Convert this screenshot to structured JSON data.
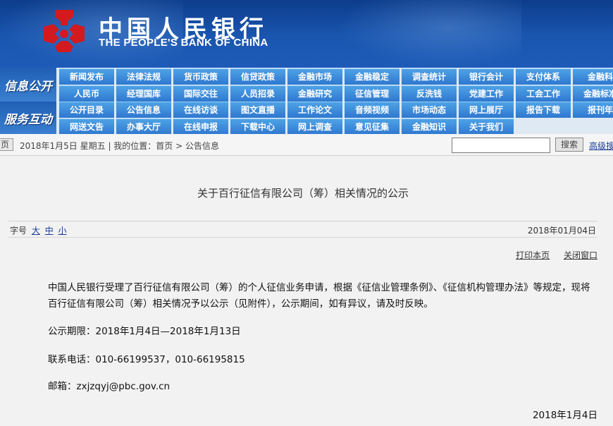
{
  "header": {
    "logo_cn": "中国人民银行",
    "logo_en": "THE PEOPLE'S BANK OF CHINA",
    "brand_color": "#c8171e"
  },
  "nav": {
    "group1_label": "信息公开",
    "group2_label": "服务互动",
    "row1": [
      "新闻发布",
      "法律法规",
      "货币政策",
      "信贷政策",
      "金融市场",
      "金融稳定",
      "调查统计",
      "银行会计",
      "支付体系",
      "金融科"
    ],
    "row2": [
      "人民币",
      "经理国库",
      "国际交往",
      "人员招录",
      "金融研究",
      "征信管理",
      "反洗钱",
      "党建工作",
      "工会工作",
      "金融标准"
    ],
    "row3": [
      "公开目录",
      "公告信息",
      "在线访谈",
      "图文直播",
      "工作论文",
      "音频视频",
      "市场动态",
      "网上展厅",
      "报告下载",
      "报刊年"
    ],
    "row4": [
      "网送文告",
      "办事大厅",
      "在线申报",
      "下载中心",
      "网上调查",
      "意见征集",
      "金融知识",
      "关于我们"
    ]
  },
  "crumbbar": {
    "home": "页",
    "text": "2018年1月5日  星期五  |  我的位置：首页   >  公告信息",
    "search_placeholder": "",
    "search_button": "搜索",
    "advanced": "高级搜"
  },
  "article": {
    "title": "关于百行征信有限公司（筹）相关情况的公示",
    "font_label": "字号",
    "font_large": "大",
    "font_medium": "中",
    "font_small": "小",
    "date": "2018年01月04日",
    "print": "打印本页",
    "close": "关闭窗口",
    "p1": "中国人民银行受理了百行征信有限公司（筹）的个人征信业务申请，根据《征信业管理条例》、《征信机构管理办法》等规定，现将百行征信有限公司（筹）相关情况予以公示（见附件），公示期间，如有异议，请及时反映。",
    "p2": "公示期限：2018年1月4日—2018年1月13日",
    "p3": "联系电话：010-66199537，010-66195815",
    "p4": "邮箱：zxjzqyj@pbc.gov.cn",
    "sign_date": "2018年1月4日"
  }
}
